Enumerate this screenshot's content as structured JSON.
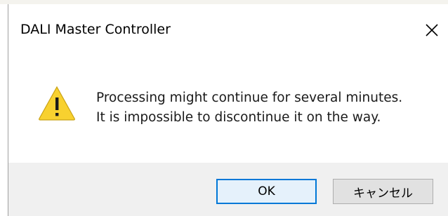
{
  "window": {
    "title": "DALI Master Controller",
    "close_icon": "close-icon"
  },
  "message": {
    "icon": "warning-icon",
    "line1": "Processing might continue for several minutes.",
    "line2": "It is impossible to discontinue it on the way."
  },
  "buttons": {
    "ok_label": "OK",
    "cancel_label": "キャンセル"
  },
  "colors": {
    "warning_fill": "#f8d12f",
    "focus_border": "#0078d7",
    "button_bar_bg": "#f0f0f0"
  }
}
